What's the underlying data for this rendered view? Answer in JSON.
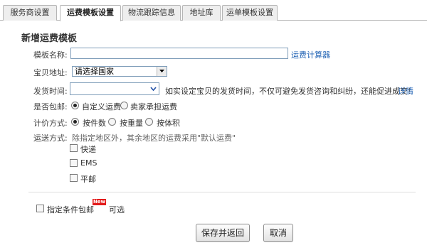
{
  "tabs": [
    {
      "label": "服务商设置",
      "active": false
    },
    {
      "label": "运费模板设置",
      "active": true
    },
    {
      "label": "物流跟踪信息",
      "active": false
    },
    {
      "label": "地址库",
      "active": false
    },
    {
      "label": "运单模板设置",
      "active": false
    }
  ],
  "form": {
    "title": "新增运费模板",
    "template_name": {
      "label": "模板名称:",
      "value": "",
      "calc_link": "运费计算器"
    },
    "address": {
      "label": "宝贝地址:",
      "selected": "请选择国家"
    },
    "ship_time": {
      "label": "发货时间:",
      "selected": "",
      "hint": "如实设定宝贝的发货时间，不仅可避免发货咨询和纠纷，还能促进成交!",
      "detail_link": "详情"
    },
    "free_shipping": {
      "label": "是否包邮:",
      "options": [
        {
          "label": "自定义运费",
          "checked": true
        },
        {
          "label": "卖家承担运费",
          "checked": false
        }
      ]
    },
    "pricing": {
      "label": "计价方式:",
      "options": [
        {
          "label": "按件数",
          "checked": true
        },
        {
          "label": "按重量",
          "checked": false
        },
        {
          "label": "按体积",
          "checked": false
        }
      ]
    },
    "delivery": {
      "label": "运送方式:",
      "hint": "除指定地区外，其余地区的运费采用\"默认运费\"",
      "options": [
        {
          "label": "快递",
          "checked": false
        },
        {
          "label": "EMS",
          "checked": false
        },
        {
          "label": "平邮",
          "checked": false
        }
      ]
    },
    "conditional_free": {
      "label": "指定条件包邮",
      "badge": "New",
      "suffix": "可选",
      "checked": false
    }
  },
  "buttons": {
    "save": "保存并返回",
    "cancel": "取消"
  },
  "colors": {
    "link": "#2263b4",
    "badge": "#e31b1b",
    "border": "#7f9db9"
  }
}
